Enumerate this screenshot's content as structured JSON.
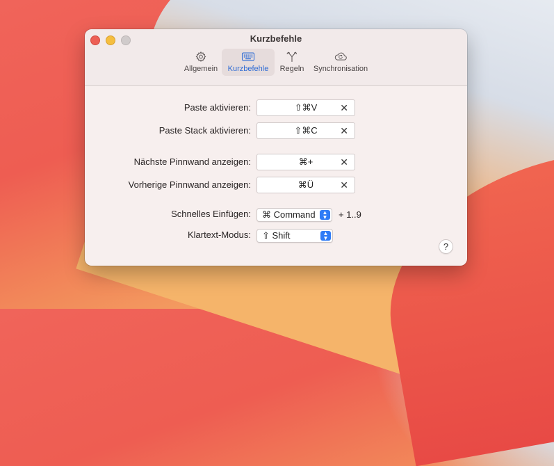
{
  "window": {
    "title": "Kurzbefehle"
  },
  "toolbar": {
    "items": [
      {
        "label": "Allgemein",
        "icon": "gear-icon",
        "active": false
      },
      {
        "label": "Kurzbefehle",
        "icon": "keyboard-icon",
        "active": true
      },
      {
        "label": "Regeln",
        "icon": "branch-icon",
        "active": false
      },
      {
        "label": "Synchronisation",
        "icon": "cloud-sync-icon",
        "active": false
      }
    ]
  },
  "shortcuts": [
    {
      "label": "Paste aktivieren:",
      "keys": "⇧⌘V"
    },
    {
      "label": "Paste Stack aktivieren:",
      "keys": "⇧⌘C"
    },
    {
      "label": "Nächste Pinnwand anzeigen:",
      "keys": "⌘+"
    },
    {
      "label": "Vorherige Pinnwand anzeigen:",
      "keys": "⌘Ü"
    }
  ],
  "quick_paste": {
    "label": "Schnelles Einfügen:",
    "value": "⌘ Command",
    "suffix": "+  1..9"
  },
  "plain_text": {
    "label": "Klartext-Modus:",
    "value": "⇧ Shift"
  },
  "help": {
    "label": "?"
  },
  "clear_glyph": "✕",
  "colors": {
    "accent": "#2f7cf6",
    "active_tab_text": "#2e6bd4"
  }
}
